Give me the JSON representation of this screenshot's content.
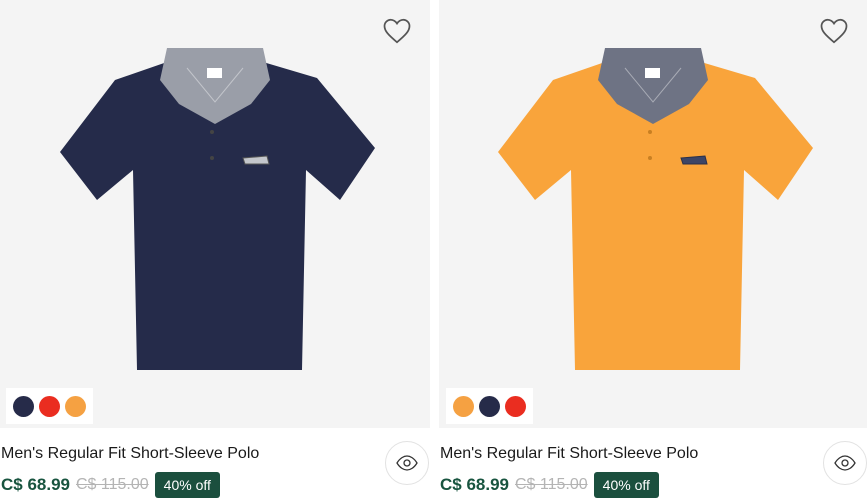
{
  "products": [
    {
      "title": "Men's Regular Fit Short-Sleeve Polo",
      "price": "C$ 68.99",
      "old_price": "C$ 115.00",
      "discount": "40% off",
      "shirt_color": "#252b4a",
      "collar_color": "#9a9ea8",
      "swatches": [
        {
          "name": "navy",
          "color": "#262b49"
        },
        {
          "name": "red",
          "color": "#ea2d20"
        },
        {
          "name": "orange",
          "color": "#f5a142"
        }
      ]
    },
    {
      "title": "Men's Regular Fit Short-Sleeve Polo",
      "price": "C$ 68.99",
      "old_price": "C$ 115.00",
      "discount": "40% off",
      "shirt_color": "#f9a43b",
      "collar_color": "#6e7384",
      "swatches": [
        {
          "name": "orange",
          "color": "#f5a142"
        },
        {
          "name": "navy",
          "color": "#262b49"
        },
        {
          "name": "red",
          "color": "#ea2d20"
        }
      ]
    }
  ],
  "icons": {
    "wishlist": "heart-icon",
    "quick_view": "eye-icon",
    "logo": "crocodile-logo-icon"
  }
}
